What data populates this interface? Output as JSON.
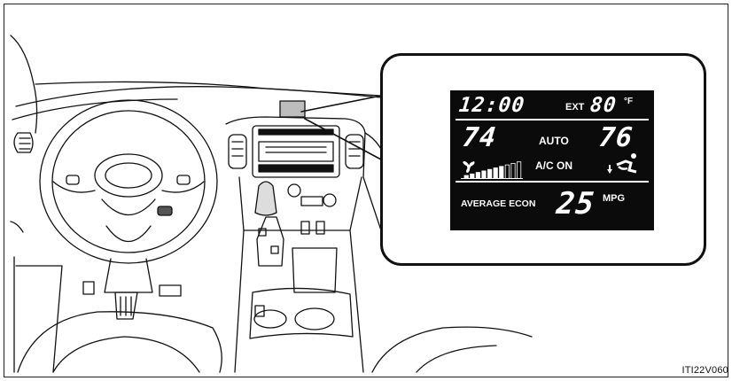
{
  "figure": {
    "code": "ITI22V060"
  },
  "lcd": {
    "clock": "12:00",
    "ext_label": "EXT",
    "ext_temp": "80",
    "temp_unit": "°F",
    "left_temp": "74",
    "mode": "AUTO",
    "right_temp": "76",
    "ac_status": "A/C ON",
    "fan_level": 0.7,
    "economy_label": "AVERAGE ECON",
    "economy_value": "25",
    "economy_unit": "MPG"
  },
  "icons": {
    "fan": "fan-icon",
    "airflow": "airflow-mode-icon",
    "fan_bar": "fan-speed-bar"
  }
}
